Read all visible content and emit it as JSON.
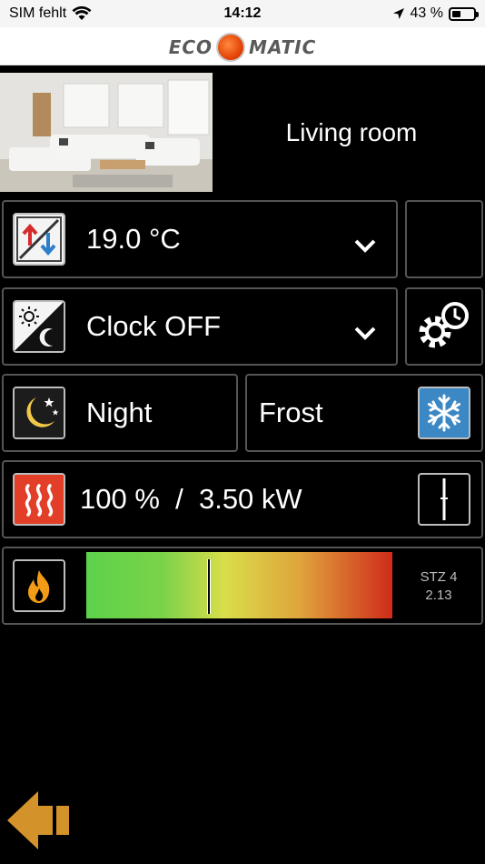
{
  "status_bar": {
    "carrier": "SIM fehlt",
    "time": "14:12",
    "battery": "43 %",
    "battery_level": 0.43
  },
  "header": {
    "logo_left": "ECO",
    "logo_right": "MATIC"
  },
  "room": {
    "name": "Living room"
  },
  "setpoint": {
    "icon": "temperature-up-down-icon",
    "value": "19.0 °C"
  },
  "clock": {
    "icon": "day-night-icon",
    "value": "Clock OFF"
  },
  "modes": {
    "night_icon": "moon-stars-icon",
    "night_label": "Night",
    "frost_label": "Frost",
    "frost_icon": "snowflake-icon"
  },
  "heater": {
    "icon": "heating-element-icon",
    "value": "100 %  /  3.50 kW",
    "window_icon": "window-icon"
  },
  "gauge": {
    "icon": "flame-icon",
    "marker_fraction": 0.4,
    "stz_label": "STZ 4",
    "version": "2.13"
  },
  "colors": {
    "background": "#000000",
    "tile_border": "#555555",
    "back_arrow": "#d3922a"
  }
}
